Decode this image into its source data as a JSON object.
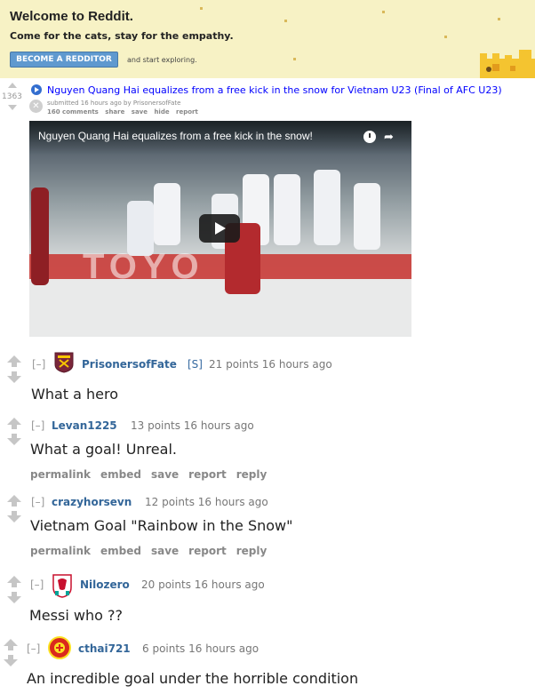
{
  "banner": {
    "title": "Welcome to Reddit.",
    "subtitle": "Come for the cats, stay for the empathy.",
    "button": "BECOME A REDDITOR",
    "explore": "and start exploring."
  },
  "post": {
    "rank": "1363",
    "title": "Nguyen Quang Hai equalizes from a free kick in the snow for Vietnam U23 (Final of AFC U23)",
    "submitted": "submitted 16 hours ago by PrisonersofFate",
    "actions": [
      "160 comments",
      "share",
      "save",
      "hide",
      "report"
    ]
  },
  "video": {
    "title": "Nguyen Quang Hai equalizes from a free kick in the snow!",
    "sponsor_text": "TOYO"
  },
  "comments": [
    {
      "author": "PrisonersofFate",
      "flair": "[S]",
      "tagline": "21 points 16 hours ago",
      "body": "What a hero",
      "crest": "west-ham-crest-icon"
    },
    {
      "author": "Levan1225",
      "flair": "",
      "tagline": "13 points 16 hours ago",
      "body": "What a goal! Unreal.",
      "actions": [
        "permalink",
        "embed",
        "save",
        "report",
        "reply"
      ]
    },
    {
      "author": "crazyhorsevn",
      "flair": "",
      "tagline": "12 points 16 hours ago",
      "body": "Vietnam Goal \"Rainbow in the Snow\"",
      "actions": [
        "permalink",
        "embed",
        "save",
        "report",
        "reply"
      ]
    },
    {
      "author": "Nilozero",
      "flair": "",
      "tagline": "20 points 16 hours ago",
      "body": "Messi who ??",
      "crest": "liverpool-crest-icon"
    },
    {
      "author": "cthai721",
      "flair": "",
      "tagline": "6 points 16 hours ago",
      "body": "An incredible goal under the horrible condition",
      "crest": "man-united-crest-icon"
    }
  ],
  "collapse_label": "[–]",
  "colors": {
    "banner_bg": "#f7f2c5",
    "link_blue": "#0000ff",
    "author_blue": "#336699",
    "button_blue": "#5f99cf"
  }
}
